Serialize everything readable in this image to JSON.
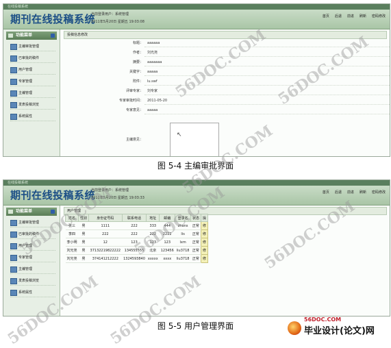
{
  "fig_a": {
    "topbar": "在线投稿系统",
    "app_title": "期刊在线投稿系统",
    "user_line": "当前登录用户：系统管理",
    "date_line": "2011年5月20日 星期五 19:03:08",
    "nav": [
      "首页",
      "后退",
      "前进",
      "刷新",
      "密码修改"
    ],
    "menu_title": "功能菜单",
    "menu": [
      "主编审批管理",
      "已审批的稿件",
      "用户管理",
      "专家管理",
      "主编管理",
      "发表投稿浏览",
      "系统属性"
    ],
    "panel_title": "投稿信息修改",
    "form": [
      {
        "label": "标题：",
        "value": "aaaaaa"
      },
      {
        "label": "作者：",
        "value": "刘光尧"
      },
      {
        "label": "摘要：",
        "value": "aaaaaaa"
      },
      {
        "label": "关键字：",
        "value": "aaaaa"
      },
      {
        "label": "附件：",
        "value": "lu.swf"
      },
      {
        "label": "评审专家：",
        "value": "刘专家"
      },
      {
        "label": "专家审批时间：",
        "value": "2011-05-20"
      },
      {
        "label": "专家意见：",
        "value": "aaaaa"
      }
    ],
    "opinion_label": "主编意见：",
    "caption": "图 5-4 主编审批界面"
  },
  "fig_b": {
    "topbar": "在线投稿系统",
    "app_title": "期刊在线投稿系统",
    "user_line": "当前登录用户：系统管理",
    "date_line": "2011年5月20日 星期五 19:03:33",
    "nav": [
      "首页",
      "后退",
      "前进",
      "刷新",
      "密码修改"
    ],
    "menu_title": "功能菜单",
    "menu": [
      "主编审批管理",
      "已审批的稿件",
      "用户管理",
      "专家管理",
      "主编管理",
      "发表投稿浏览",
      "系统属性"
    ],
    "panel_title": "用户管理",
    "columns": [
      "姓名",
      "性别",
      "身份证号码",
      "联系电话",
      "地址",
      "邮编",
      "登录名",
      "状态",
      "操"
    ],
    "rows": [
      [
        "张三",
        "男",
        "1111",
        "222",
        "333",
        "444",
        "zhans",
        "正常",
        "修"
      ],
      [
        "李四",
        "男",
        "222",
        "222",
        "222",
        "2222",
        "lis",
        "正常",
        "修"
      ],
      [
        "李小明",
        "男",
        "12",
        "123",
        "123",
        "123",
        "lxm",
        "正常",
        "修"
      ],
      [
        "刘光尧",
        "男",
        "37132219822222",
        "134555555",
        "北京",
        "123456",
        "liu3718",
        "正常",
        "修"
      ],
      [
        "刘光尧",
        "男",
        "374141212222",
        "1324593840",
        "xxxxx",
        "xxxx",
        "liu3718",
        "正常",
        "修"
      ]
    ],
    "caption": "图 5-5 用户管理界面"
  },
  "watermark": "56DOC.COM",
  "logo": {
    "site": "56DOC.COM",
    "text": "毕业设计(论文)网"
  }
}
